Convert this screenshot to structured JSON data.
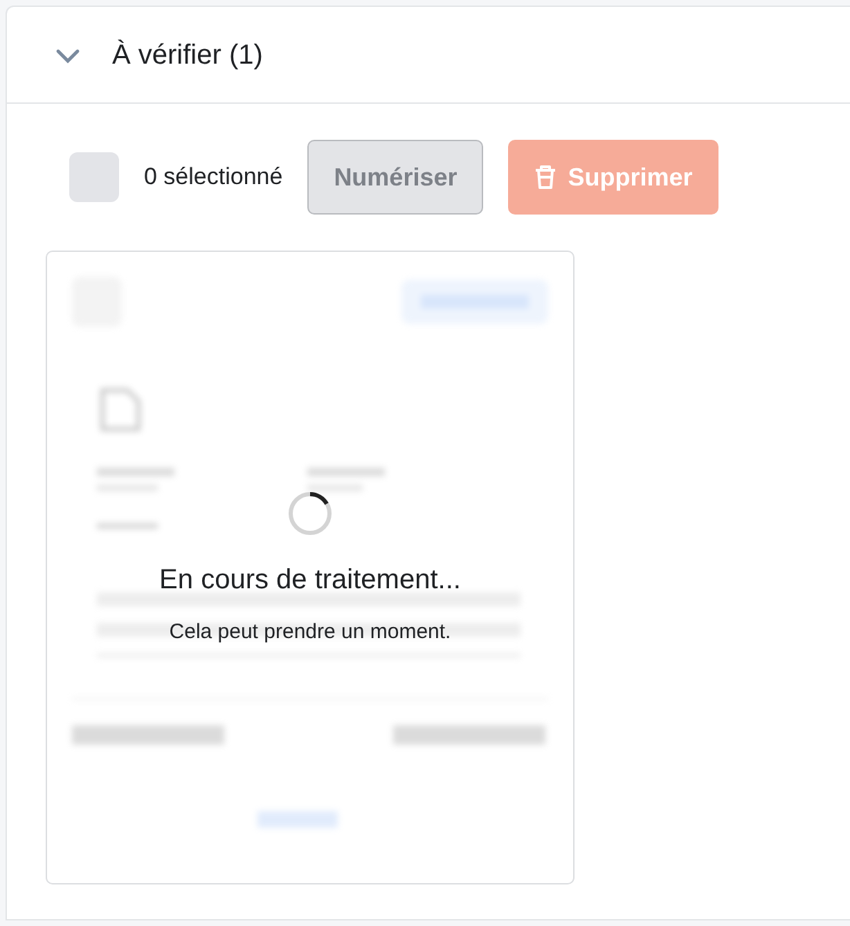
{
  "section": {
    "title": "À vérifier (1)",
    "expanded": true
  },
  "toolbar": {
    "select_all": {
      "checked": false
    },
    "selection_count": "0 sélectionné",
    "buttons": [
      {
        "label": "Numériser",
        "kind": "secondary",
        "disabled": true
      },
      {
        "label": "Supprimer",
        "kind": "danger",
        "disabled": true
      }
    ]
  },
  "documents": [
    {
      "processing": true,
      "processing_title": "En cours de traitement...",
      "processing_message": "Cela peut prendre un moment."
    }
  ]
}
